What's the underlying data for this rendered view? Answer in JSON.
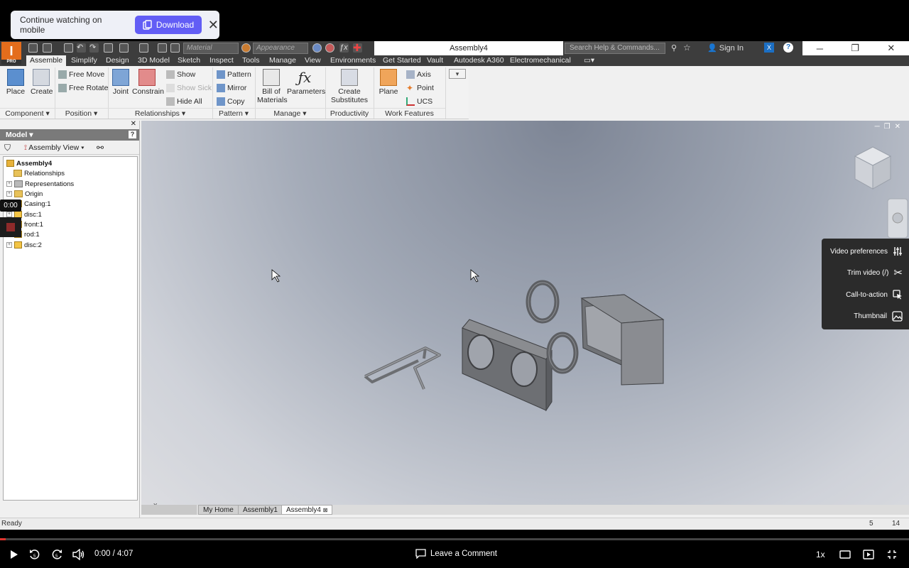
{
  "banner": {
    "text": "Continue watching on mobile",
    "download_label": "Download",
    "close_glyph": "✕"
  },
  "inventor": {
    "logo_letter": "I",
    "logo_sub": "PRO",
    "material_placeholder": "Material",
    "appearance_placeholder": "Appearance",
    "document_title": "Assembly4",
    "help_search_placeholder": "Search Help & Commands...",
    "sign_in": "Sign In",
    "ribbon_tabs": [
      "Assemble",
      "Simplify",
      "Design",
      "3D Model",
      "Sketch",
      "Inspect",
      "Tools",
      "Manage",
      "View",
      "Environments",
      "Get Started",
      "Vault",
      "Autodesk A360",
      "Electromechanical"
    ],
    "ribbon": {
      "place": "Place",
      "create": "Create",
      "free_move": "Free Move",
      "free_rotate": "Free Rotate",
      "joint": "Joint",
      "constrain": "Constrain",
      "show": "Show",
      "show_sick": "Show Sick",
      "hide_all": "Hide All",
      "pattern": "Pattern",
      "mirror": "Mirror",
      "copy": "Copy",
      "bill_line1": "Bill of",
      "bill_line2": "Materials",
      "parameters": "Parameters",
      "create_sub_line1": "Create",
      "create_sub_line2": "Substitutes",
      "plane": "Plane",
      "axis": "Axis",
      "point": "Point",
      "ucs": "UCS"
    },
    "panels": {
      "component": "Component ▾",
      "position": "Position ▾",
      "relationships": "Relationships ▾",
      "pattern": "Pattern ▾",
      "manage": "Manage ▾",
      "productivity": "Productivity",
      "work_features": "Work Features"
    },
    "browser": {
      "title": "Model ▾",
      "view": "Assembly View",
      "tree": [
        "Assembly4",
        "Relationships",
        "Representations",
        "Origin",
        "Casing:1",
        "disc:1",
        "front:1",
        "rod:1",
        "disc:2"
      ]
    },
    "doc_tabs": [
      "My Home",
      "Assembly1",
      "Assembly4"
    ],
    "status": {
      "text": "Ready",
      "num1": "5",
      "num2": "14"
    }
  },
  "side_menu": {
    "items": [
      "Video preferences",
      "Trim video (/)",
      "Call-to-action",
      "Thumbnail"
    ]
  },
  "overlay": {
    "timestamp": "0:00"
  },
  "player": {
    "time": "0:00 / 4:07",
    "comment": "Leave a Comment",
    "speed": "1x",
    "progress": 0.0
  },
  "colors": {
    "brand_purple": "#625df5",
    "inventor_orange": "#e46d1c",
    "progress_red": "#e0342e"
  }
}
